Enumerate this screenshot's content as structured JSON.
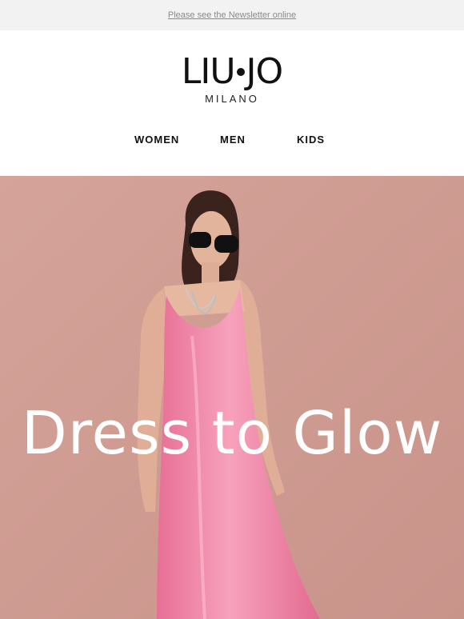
{
  "top_bar": {
    "newsletter_link": "Please see the Newsletter online"
  },
  "header": {
    "logo_text_left": "LIU",
    "logo_text_right": "JO",
    "logo_subtext": "MILANO"
  },
  "nav": {
    "items": [
      {
        "label": "WOMEN"
      },
      {
        "label": "MEN"
      },
      {
        "label": "KIDS"
      }
    ]
  },
  "hero": {
    "title": "Dress to Glow",
    "image": "woman-in-pink-slip-dress-photo",
    "background_color": "#cf9d93",
    "dress_color": "#f08aa8"
  }
}
